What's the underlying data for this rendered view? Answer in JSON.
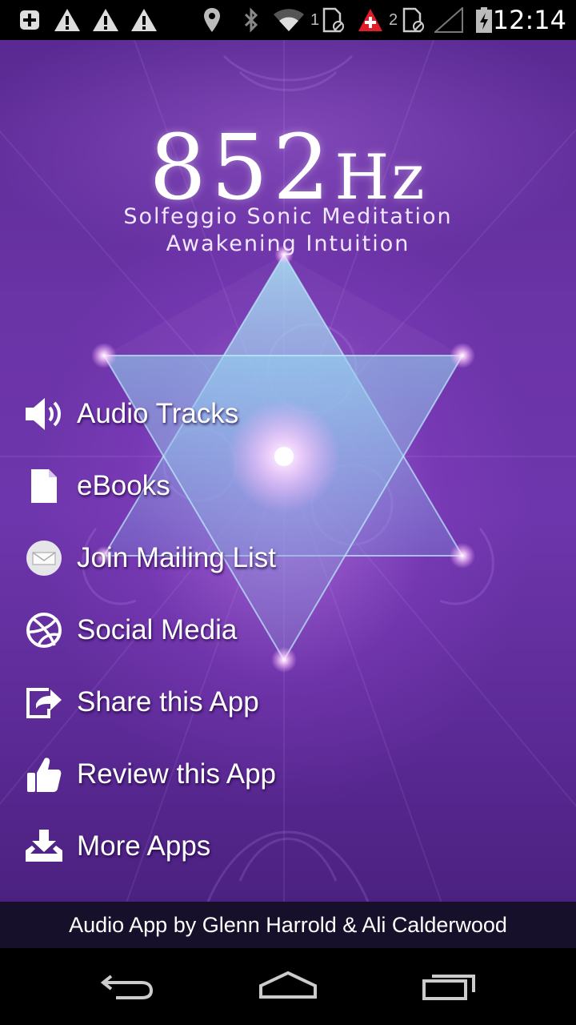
{
  "status_bar": {
    "time": "12:14",
    "sim1": "1",
    "sim2": "2",
    "icons": [
      "add-icon",
      "warning-icon",
      "warning-icon",
      "warning-icon",
      "location-icon",
      "bluetooth-icon",
      "wifi-icon",
      "sim1-icon",
      "alert-icon",
      "sim2-icon",
      "signal-icon",
      "battery-charging-icon"
    ]
  },
  "logo": {
    "number": "852",
    "unit": "Hz",
    "subtitle1": "Solfeggio Sonic Meditation",
    "subtitle2": "Awakening Intuition"
  },
  "menu": {
    "items": [
      {
        "label": "Audio Tracks",
        "icon": "speaker-icon"
      },
      {
        "label": "eBooks",
        "icon": "document-icon"
      },
      {
        "label": "Join Mailing List",
        "icon": "envelope-icon"
      },
      {
        "label": "Social Media",
        "icon": "dribbble-icon"
      },
      {
        "label": "Share this App",
        "icon": "share-icon"
      },
      {
        "label": "Review this App",
        "icon": "thumbs-up-icon"
      },
      {
        "label": "More Apps",
        "icon": "download-icon"
      }
    ]
  },
  "footer": {
    "text": "Audio App by Glenn Harrold & Ali Calderwood"
  },
  "nav": {
    "icons": [
      "back-icon",
      "home-icon",
      "recents-icon"
    ]
  },
  "colors": {
    "background_top": "#5a2a92",
    "background_mid": "#6e36ac",
    "star_fill": "#9fd8f0",
    "footer_bg": "#16102a",
    "text": "#ffffff"
  }
}
